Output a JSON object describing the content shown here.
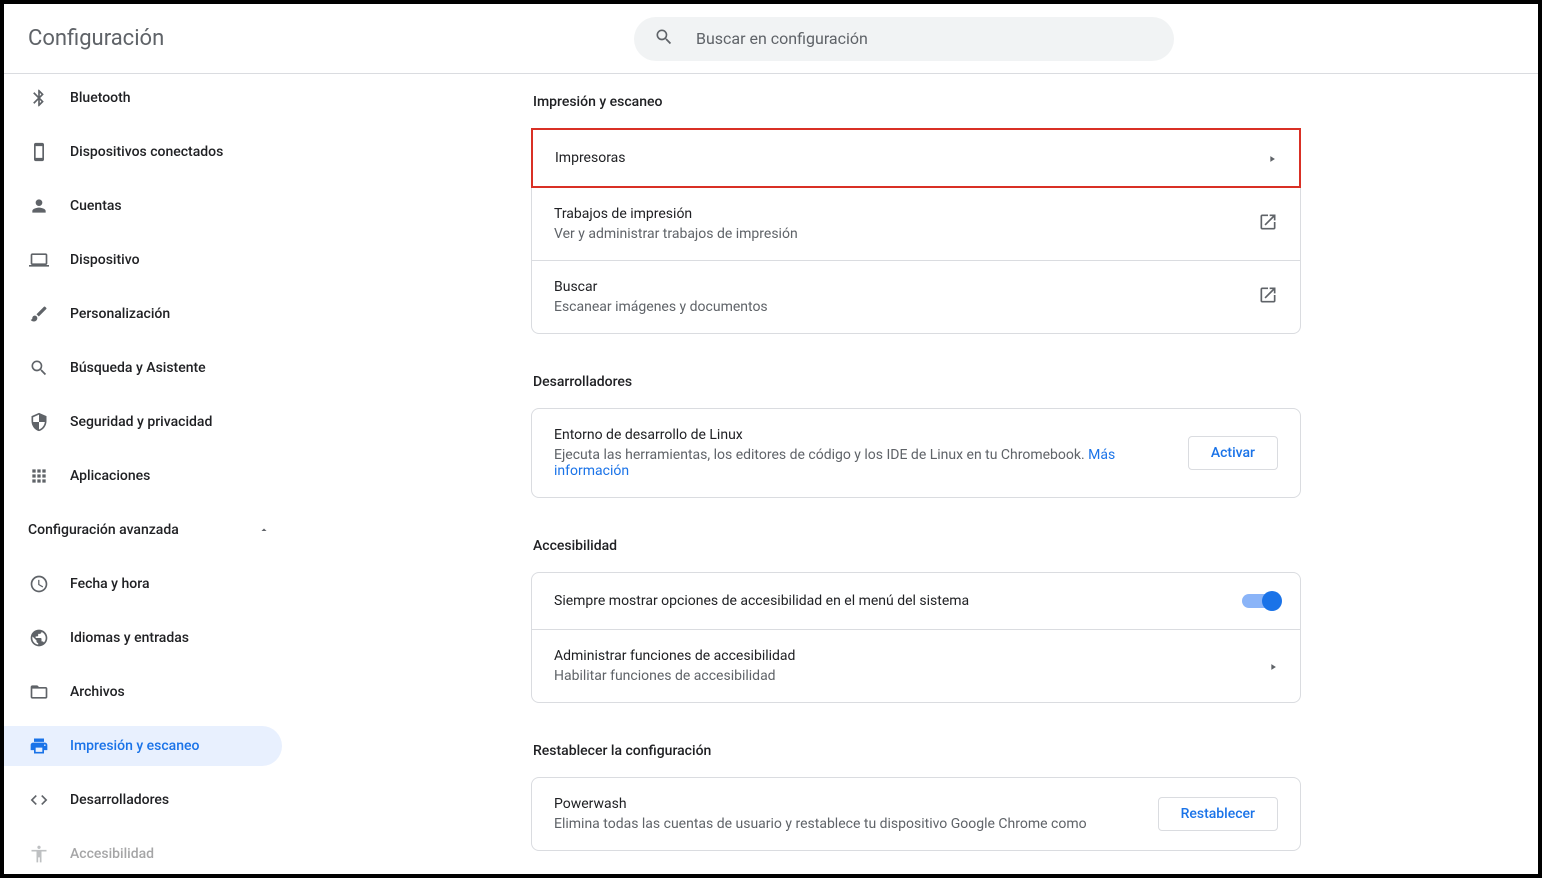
{
  "header": {
    "title": "Configuración",
    "search_placeholder": "Buscar en configuración"
  },
  "sidebar": {
    "items": [
      {
        "label": "Bluetooth"
      },
      {
        "label": "Dispositivos conectados"
      },
      {
        "label": "Cuentas"
      },
      {
        "label": "Dispositivo"
      },
      {
        "label": "Personalización"
      },
      {
        "label": "Búsqueda y Asistente"
      },
      {
        "label": "Seguridad y privacidad"
      },
      {
        "label": "Aplicaciones"
      }
    ],
    "advanced_label": "Configuración avanzada",
    "advanced_items": [
      {
        "label": "Fecha y hora"
      },
      {
        "label": "Idiomas y entradas"
      },
      {
        "label": "Archivos"
      },
      {
        "label": "Impresión y escaneo"
      },
      {
        "label": "Desarrolladores"
      },
      {
        "label": "Accesibilidad"
      }
    ]
  },
  "main": {
    "print_section": {
      "title": "Impresión y escaneo",
      "printers": "Impresoras",
      "jobs_title": "Trabajos de impresión",
      "jobs_sub": "Ver y administrar trabajos de impresión",
      "scan_title": "Buscar",
      "scan_sub": "Escanear imágenes y documentos"
    },
    "dev_section": {
      "title": "Desarrolladores",
      "linux_title": "Entorno de desarrollo de Linux",
      "linux_sub": "Ejecuta las herramientas, los editores de código y los IDE de Linux en tu Chromebook. ",
      "linux_link": "Más información",
      "activate": "Activar"
    },
    "a11y_section": {
      "title": "Accesibilidad",
      "always_show": "Siempre mostrar opciones de accesibilidad en el menú del sistema",
      "manage_title": "Administrar funciones de accesibilidad",
      "manage_sub": "Habilitar funciones de accesibilidad"
    },
    "reset_section": {
      "title": "Restablecer la configuración",
      "powerwash_title": "Powerwash",
      "powerwash_sub": "Elimina todas las cuentas de usuario y restablece tu dispositivo Google Chrome como",
      "reset_btn": "Restablecer"
    }
  }
}
